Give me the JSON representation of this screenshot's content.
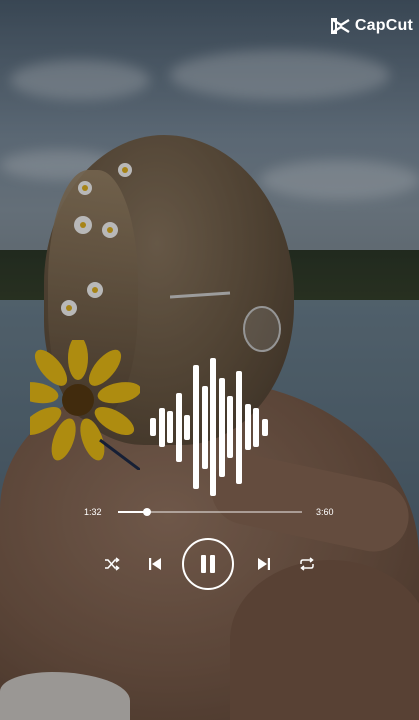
{
  "brand": {
    "name": "CapCut",
    "logo_icon": "capcut-logo-icon"
  },
  "player": {
    "elapsed": "1:32",
    "duration": "3:60",
    "progress_fraction": 0.16,
    "controls": {
      "shuffle_icon": "shuffle-icon",
      "previous_icon": "previous-icon",
      "play_pause_icon": "pause-icon",
      "next_icon": "next-icon",
      "repeat_icon": "repeat-icon"
    },
    "waveform_levels": [
      0.13,
      0.28,
      0.23,
      0.5,
      0.18,
      0.9,
      0.6,
      1.0,
      0.72,
      0.45,
      0.82,
      0.33,
      0.28,
      0.12
    ]
  },
  "colors": {
    "foreground": "#ffffff",
    "overlay": "rgba(0,0,0,0.28)"
  }
}
